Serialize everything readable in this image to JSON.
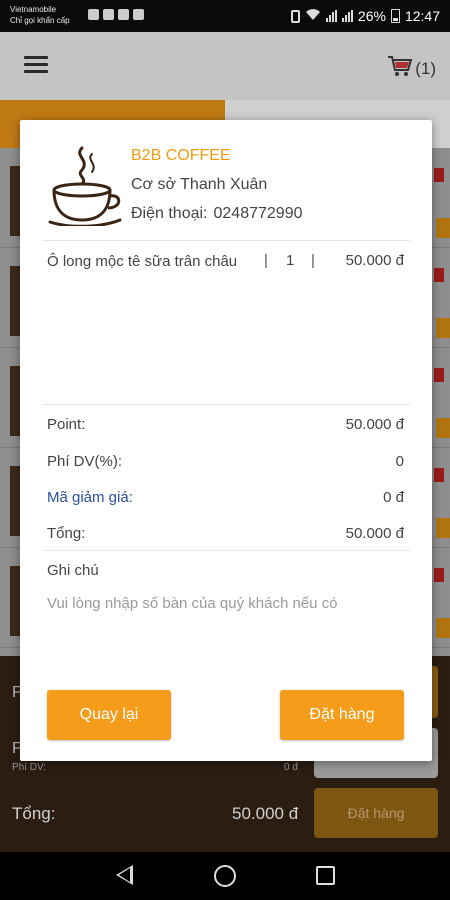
{
  "status_bar": {
    "carrier_line1": "Vietnamobile",
    "carrier_line2": "Chỉ gọi khẩn cấp",
    "battery": "26%",
    "time": "12:47"
  },
  "app_bar": {
    "cart_count": "(1)"
  },
  "background": {
    "service_fee_label": "Phí DV:",
    "service_fee_value": "0 đ",
    "total_label": "Tổng:",
    "total_value": "50.000 đ",
    "order_button": "Đặt hàng"
  },
  "dialog": {
    "shop_name": "B2B COFFEE",
    "branch": "Cơ sở Thanh Xuân",
    "phone_label": "Điện thoại:",
    "phone_value": "0248772990",
    "items": [
      {
        "name": "Ô long mộc tê sữa trân châu",
        "sep": "|",
        "qty": "1",
        "price": "50.000 đ"
      }
    ],
    "summary": {
      "point_label": "Point:",
      "point_value": "50.000 đ",
      "fee_label": "Phí DV(%):",
      "fee_value": "0",
      "discount_label": "Mã giảm giá:",
      "discount_value": "0 đ",
      "total_label": "Tổng:",
      "total_value": "50.000 đ"
    },
    "note_title": "Ghi chú",
    "note_placeholder": "Vui lòng nhập số bàn của quý khách nếu có",
    "back_button": "Quay lại",
    "order_button": "Đặt hàng"
  },
  "colors": {
    "accent": "#f59c1a",
    "shop_name": "#f39c12",
    "discount_label": "#2a4ea0"
  }
}
